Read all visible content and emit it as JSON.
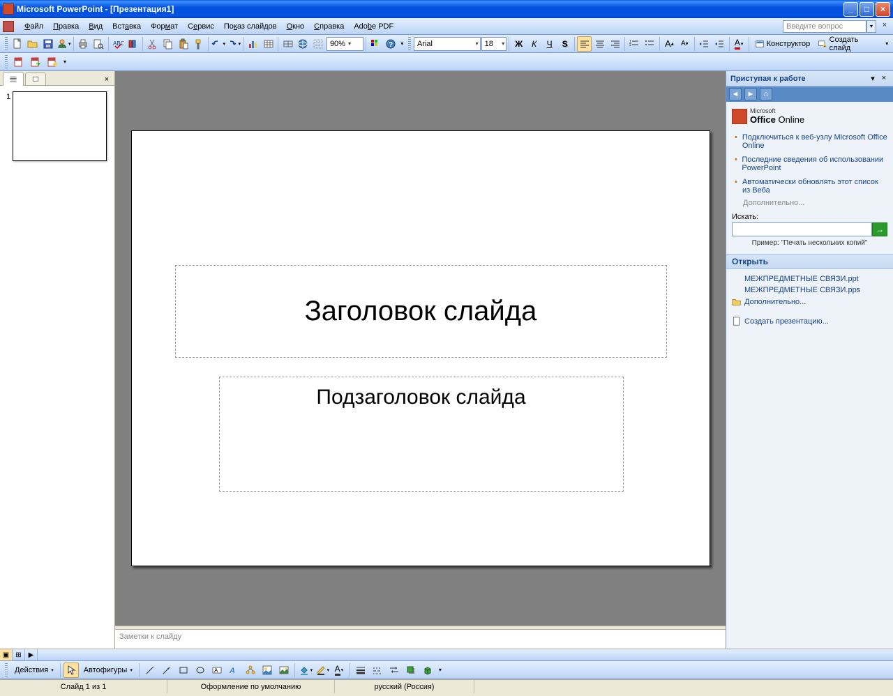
{
  "app": {
    "title": "Microsoft PowerPoint - [Презентация1]"
  },
  "menu": {
    "file": "Файл",
    "edit": "Правка",
    "view": "Вид",
    "insert": "Вставка",
    "format": "Формат",
    "tools": "Сервис",
    "slideshow": "Показ слайдов",
    "window": "Окно",
    "help": "Справка",
    "adobepdf": "Adobe PDF",
    "help_placeholder": "Введите вопрос"
  },
  "toolbar": {
    "zoom": "90%",
    "font_name": "Arial",
    "font_size": "18",
    "design": "Конструктор",
    "new_slide": "Создать слайд"
  },
  "slide": {
    "number": "1",
    "title_placeholder": "Заголовок слайда",
    "subtitle_placeholder": "Подзаголовок слайда"
  },
  "notes": {
    "placeholder": "Заметки к слайду"
  },
  "taskpane": {
    "title": "Приступая к работе",
    "office_online": "Office Online",
    "microsoft": "Microsoft",
    "link_connect": "Подключиться к веб-узлу Microsoft Office Online",
    "link_news": "Последние сведения об использовании PowerPoint",
    "link_update": "Автоматически обновлять этот список из Веба",
    "link_more": "Дополнительно...",
    "search_label": "Искать:",
    "search_example": "Пример: \"Печать нескольких копий\"",
    "open_section": "Открыть",
    "file1": "МЕЖПРЕДМЕТНЫЕ СВЯЗИ.ppt",
    "file2": "МЕЖПРЕДМЕТНЫЕ СВЯЗИ.pps",
    "open_more": "Дополнительно...",
    "create_presentation": "Создать презентацию..."
  },
  "drawing": {
    "actions": "Действия",
    "autoshapes": "Автофигуры"
  },
  "status": {
    "slide_info": "Слайд 1 из 1",
    "design": "Оформление по умолчанию",
    "language": "русский (Россия)"
  }
}
